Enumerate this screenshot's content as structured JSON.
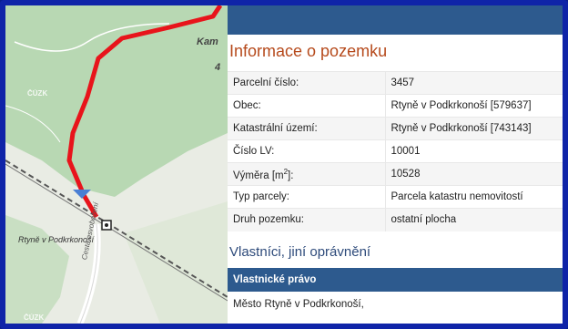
{
  "map": {
    "labels": {
      "hill": "Kam",
      "hill_number": "4",
      "town": "Rtyně v Podkrkonoší",
      "street": "Cesta osvobození"
    },
    "watermark": "ČÚZK"
  },
  "panel": {
    "title": "Informace o pozemku",
    "rows": [
      {
        "key": "Parcelní číslo:",
        "value": "3457"
      },
      {
        "key": "Obec:",
        "value": "Rtyně v Podkrkonoší [579637]"
      },
      {
        "key": "Katastrální území:",
        "value": "Rtyně v Podkrkonoší [743143]"
      },
      {
        "key": "Číslo LV:",
        "value": "10001"
      },
      {
        "key": "Výměra [m2]:",
        "value": "10528"
      },
      {
        "key": "Typ parcely:",
        "value": "Parcela katastru nemovitostí"
      },
      {
        "key": "Druh pozemku:",
        "value": "ostatní plocha"
      }
    ],
    "owners_title": "Vlastníci, jiní oprávnění",
    "owners_band": "Vlastnické právo",
    "owner_text": "Město Rtyně v Podkrkonoší,"
  },
  "colors": {
    "frame": "#0f24a8",
    "header_band": "#2d5a8e",
    "title": "#b64a1c",
    "route": "#e8141b"
  }
}
